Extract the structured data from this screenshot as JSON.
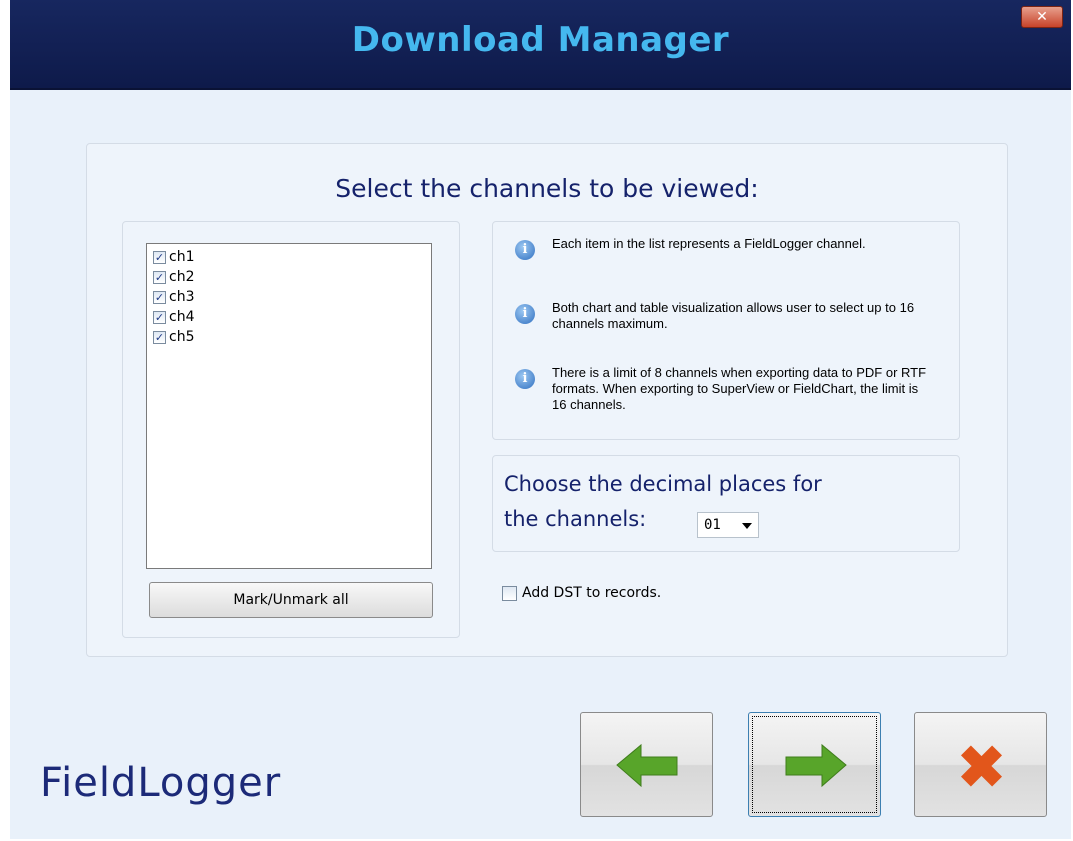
{
  "window": {
    "title": "Download Manager",
    "close_label": "✕"
  },
  "main": {
    "heading": "Select the channels to be viewed:",
    "channels": [
      {
        "label": "ch1",
        "checked": true
      },
      {
        "label": "ch2",
        "checked": true
      },
      {
        "label": "ch3",
        "checked": true
      },
      {
        "label": "ch4",
        "checked": true
      },
      {
        "label": "ch5",
        "checked": true
      }
    ],
    "mark_unmark_label": "Mark/Unmark all",
    "info": [
      {
        "icon": "info-icon",
        "text": "Each item in the list represents a FieldLogger channel."
      },
      {
        "icon": "info-icon",
        "text": "Both chart and table visualization allows user to select up to 16 channels maximum."
      },
      {
        "icon": "info-icon",
        "text": "There is a limit of 8 channels when exporting data to PDF or RTF formats. When exporting to SuperView or FieldChart, the limit is 16 channels."
      }
    ],
    "decimal": {
      "label_line1": "Choose the decimal places for",
      "label_line2": "the channels:",
      "selected": "01"
    },
    "dst": {
      "label": "Add DST to records.",
      "checked": false
    }
  },
  "footer": {
    "logo_text": "FieldLogger",
    "back_icon": "arrow-left-icon",
    "next_icon": "arrow-right-icon",
    "cancel_icon": "close-x-icon"
  },
  "colors": {
    "title": "#45b8ef",
    "titlebar": "#17275f",
    "heading": "#15226b",
    "arrow": "#58a52a",
    "cancel": "#e2561b"
  }
}
